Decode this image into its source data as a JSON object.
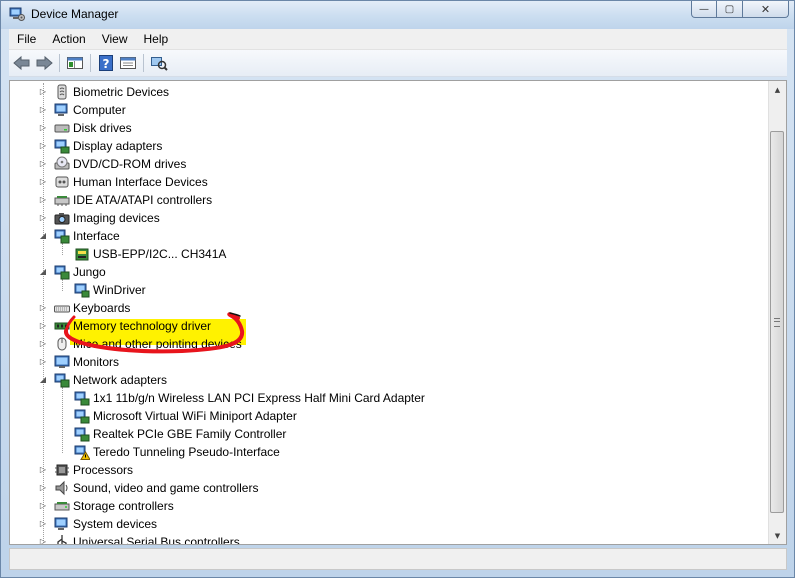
{
  "window": {
    "title": "Device Manager",
    "caption": {
      "minimize": "—",
      "maximize": "▢",
      "close": "✕"
    }
  },
  "menu": [
    "File",
    "Action",
    "View",
    "Help"
  ],
  "toolbar": [
    {
      "name": "back-icon"
    },
    {
      "name": "forward-icon"
    },
    {
      "name": "show-hide-console-tree-icon"
    },
    {
      "name": "help-icon"
    },
    {
      "name": "properties-icon"
    },
    {
      "name": "scan-hardware-icon"
    }
  ],
  "colors": {
    "highlight": "#fff200",
    "annotation": "#e8141c",
    "titlebar": "#cddff1"
  },
  "tree": [
    {
      "label": "Biometric Devices",
      "level": 0,
      "expander": "collapsed",
      "icon": "biometric-icon"
    },
    {
      "label": "Computer",
      "level": 0,
      "expander": "collapsed",
      "icon": "computer-icon"
    },
    {
      "label": "Disk drives",
      "level": 0,
      "expander": "collapsed",
      "icon": "disk-drive-icon"
    },
    {
      "label": "Display adapters",
      "level": 0,
      "expander": "collapsed",
      "icon": "display-adapter-icon"
    },
    {
      "label": "DVD/CD-ROM drives",
      "level": 0,
      "expander": "collapsed",
      "icon": "dvd-drive-icon"
    },
    {
      "label": "Human Interface Devices",
      "level": 0,
      "expander": "collapsed",
      "icon": "hid-icon"
    },
    {
      "label": "IDE ATA/ATAPI controllers",
      "level": 0,
      "expander": "collapsed",
      "icon": "ide-controller-icon"
    },
    {
      "label": "Imaging devices",
      "level": 0,
      "expander": "collapsed",
      "icon": "camera-icon"
    },
    {
      "label": "Interface",
      "level": 0,
      "expander": "expanded",
      "icon": "interface-icon"
    },
    {
      "label": "USB-EPP/I2C... CH341A",
      "level": 1,
      "expander": "none",
      "icon": "usb-device-icon",
      "highlighted": true
    },
    {
      "label": "Jungo",
      "level": 0,
      "expander": "expanded",
      "icon": "jungo-icon"
    },
    {
      "label": "WinDriver",
      "level": 1,
      "expander": "none",
      "icon": "windriver-icon"
    },
    {
      "label": "Keyboards",
      "level": 0,
      "expander": "collapsed",
      "icon": "keyboard-icon"
    },
    {
      "label": "Memory technology driver",
      "level": 0,
      "expander": "collapsed",
      "icon": "memory-icon"
    },
    {
      "label": "Mice and other pointing devices",
      "level": 0,
      "expander": "collapsed",
      "icon": "mouse-icon"
    },
    {
      "label": "Monitors",
      "level": 0,
      "expander": "collapsed",
      "icon": "monitor-icon"
    },
    {
      "label": "Network adapters",
      "level": 0,
      "expander": "expanded",
      "icon": "network-adapter-icon"
    },
    {
      "label": "1x1 11b/g/n Wireless LAN PCI Express Half Mini Card Adapter",
      "level": 1,
      "expander": "none",
      "icon": "network-card-icon"
    },
    {
      "label": "Microsoft Virtual WiFi Miniport Adapter",
      "level": 1,
      "expander": "none",
      "icon": "network-card-icon"
    },
    {
      "label": "Realtek PCIe GBE Family Controller",
      "level": 1,
      "expander": "none",
      "icon": "network-card-icon"
    },
    {
      "label": "Teredo Tunneling Pseudo-Interface",
      "level": 1,
      "expander": "none",
      "icon": "network-card-warning-icon"
    },
    {
      "label": "Processors",
      "level": 0,
      "expander": "collapsed",
      "icon": "processor-icon"
    },
    {
      "label": "Sound, video and game controllers",
      "level": 0,
      "expander": "collapsed",
      "icon": "speaker-icon"
    },
    {
      "label": "Storage controllers",
      "level": 0,
      "expander": "collapsed",
      "icon": "storage-controller-icon"
    },
    {
      "label": "System devices",
      "level": 0,
      "expander": "collapsed",
      "icon": "system-devices-icon"
    },
    {
      "label": "Universal Serial Bus controllers",
      "level": 0,
      "expander": "collapsed",
      "icon": "usb-controller-icon"
    }
  ]
}
